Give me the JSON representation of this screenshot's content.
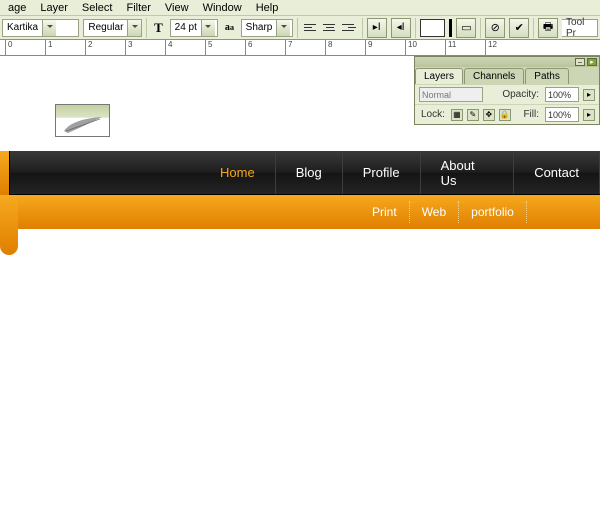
{
  "menubar": {
    "items": [
      "age",
      "Layer",
      "Select",
      "Filter",
      "View",
      "Window",
      "Help"
    ]
  },
  "options": {
    "font": "Kartika",
    "weight": "Regular",
    "size_prefix": "T",
    "size": "24 pt",
    "aa_prefix": "a_a",
    "aa": "Sharp",
    "tool_preset": "Tool Pr"
  },
  "ruler_ticks": [
    "0",
    "1",
    "2",
    "3",
    "4",
    "5",
    "6",
    "7",
    "8",
    "9",
    "10",
    "11",
    "12"
  ],
  "site": {
    "nav": [
      {
        "label": "Home",
        "active": true
      },
      {
        "label": "Blog",
        "active": false
      },
      {
        "label": "Profile",
        "active": false
      },
      {
        "label": "About Us",
        "active": false
      },
      {
        "label": "Contact",
        "active": false
      }
    ],
    "subnav": [
      "Print",
      "Web",
      "portfolio"
    ]
  },
  "panel": {
    "tabs": [
      "Layers",
      "Channels",
      "Paths"
    ],
    "blend": "Normal",
    "opacity_label": "Opacity:",
    "opacity": "100%",
    "lock_label": "Lock:",
    "fill_label": "Fill:",
    "fill": "100%"
  }
}
